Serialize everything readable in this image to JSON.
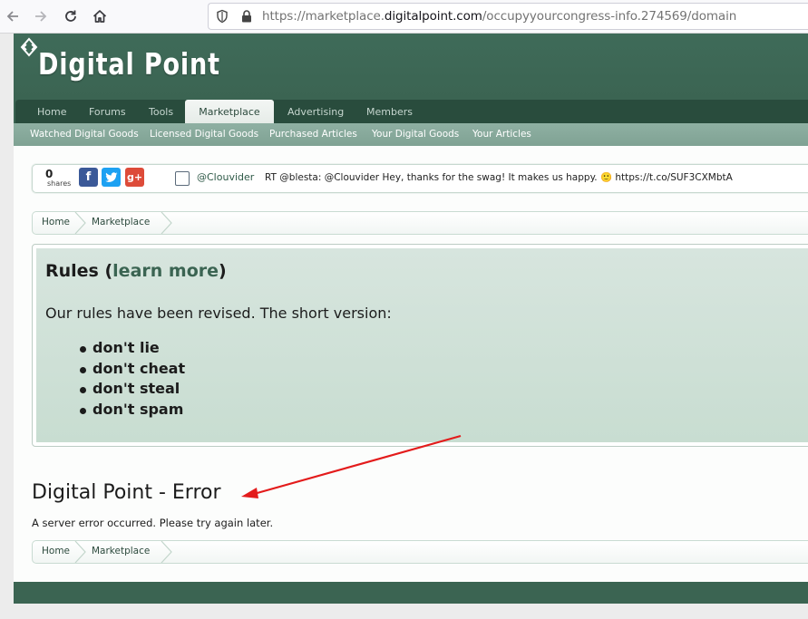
{
  "browser": {
    "url_prefix": "https://marketplace.",
    "url_domain": "digitalpoint.com",
    "url_path": "/occupyyourcongress-info.274569/domain"
  },
  "site": {
    "logo_text": "Digital Point",
    "tabs": [
      "Home",
      "Forums",
      "Tools",
      "Marketplace",
      "Advertising",
      "Members"
    ],
    "active_tab": "Marketplace",
    "subnav": [
      "Watched Digital Goods",
      "Licensed Digital Goods",
      "Purchased Articles",
      "Your Digital Goods",
      "Your Articles"
    ]
  },
  "share": {
    "count": "0",
    "label": "shares",
    "tweet_handle": "@Clouvider",
    "tweet_text": "RT @blesta: @Clouvider Hey, thanks for the swag! It makes us happy. 🙂 https://t.co/SUF3CXMbtA"
  },
  "breadcrumbs": [
    "Home",
    "Marketplace"
  ],
  "rules": {
    "title_start": "Rules (",
    "title_link": "learn more",
    "title_end": ")",
    "intro": "Our rules have been revised. The short version:",
    "items": [
      "don't lie",
      "don't cheat",
      "don't steal",
      "don't spam"
    ]
  },
  "error": {
    "title": "Digital Point - Error",
    "message": "A server error occurred. Please try again later."
  },
  "colors": {
    "brand_green": "#3b6452",
    "annotation_arrow": "#e31b1b"
  }
}
